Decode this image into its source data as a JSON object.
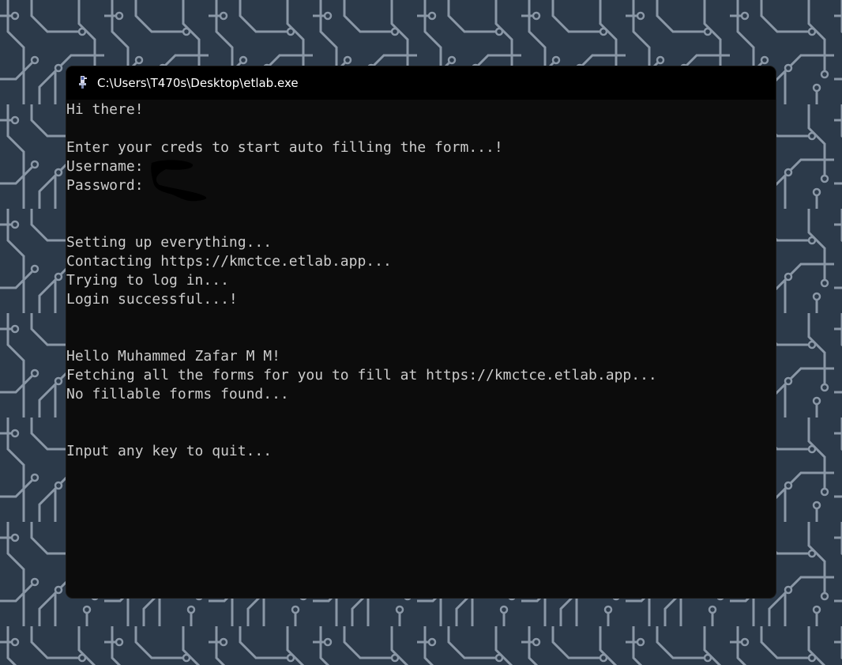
{
  "window": {
    "title": "C:\\Users\\T470s\\Desktop\\etlab.exe",
    "icon": "console-app-icon"
  },
  "console": {
    "lines": [
      "Hi there!",
      "",
      "Enter your creds to start auto filling the form...!",
      "Username: ",
      "Password: ",
      "",
      "",
      "Setting up everything...",
      "Contacting https://kmctce.etlab.app...",
      "Trying to log in...",
      "Login successful...!",
      "",
      "",
      "Hello Muhammed Zafar M M!",
      "Fetching all the forms for you to fill at https://kmctce.etlab.app...",
      "No fillable forms found...",
      "",
      "",
      "Input any key to quit..."
    ]
  },
  "colors": {
    "wallpaper": "#2c3a4a",
    "circuit": "#8a97a6",
    "console_bg": "#0c0c0c",
    "console_text": "#cccccc",
    "titlebar_bg": "#000000"
  }
}
